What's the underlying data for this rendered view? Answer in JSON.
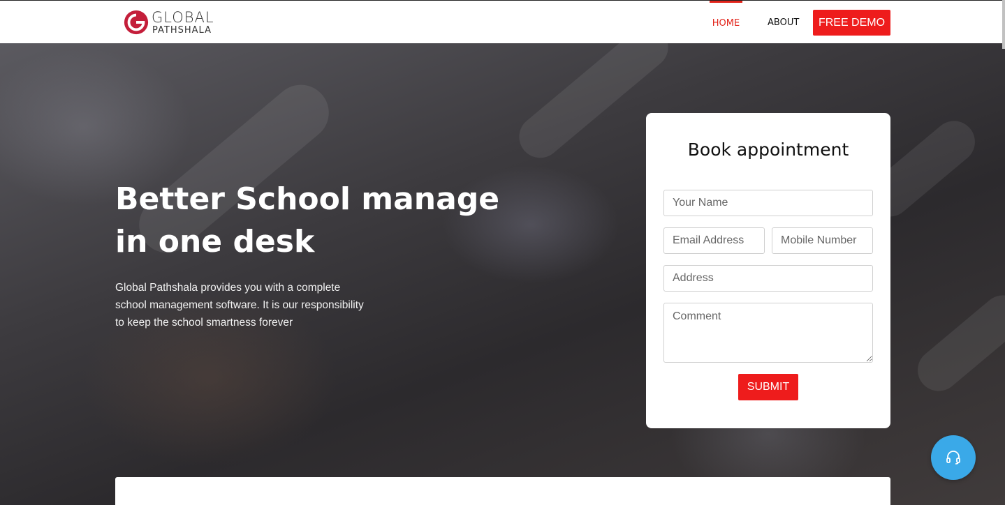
{
  "header": {
    "logo": {
      "line1": "GLOBAL",
      "line2": "PATHSHALA",
      "accent_color": "#e2231a"
    },
    "nav": {
      "home": "HOME",
      "about": "ABOUT",
      "free_demo": "FREE DEMO"
    },
    "active_item": "HOME"
  },
  "hero": {
    "title_line1": "Better School manage",
    "title_line2": "in one desk",
    "description_line1": "Global Pathshala provides you with a complete",
    "description_line2": "school management software. It is our responsibility",
    "description_line3": "to keep the school smartness forever"
  },
  "form": {
    "title": "Book appointment",
    "name_placeholder": "Your Name",
    "email_placeholder": "Email Address",
    "mobile_placeholder": "Mobile Number",
    "address_placeholder": "Address",
    "comment_placeholder": "Comment",
    "submit_label": "SUBMIT"
  },
  "support": {
    "icon": "headset-icon",
    "color": "#3aa9e8"
  },
  "colors": {
    "brand_red": "#ee1c1c",
    "nav_active": "#e2231a"
  }
}
